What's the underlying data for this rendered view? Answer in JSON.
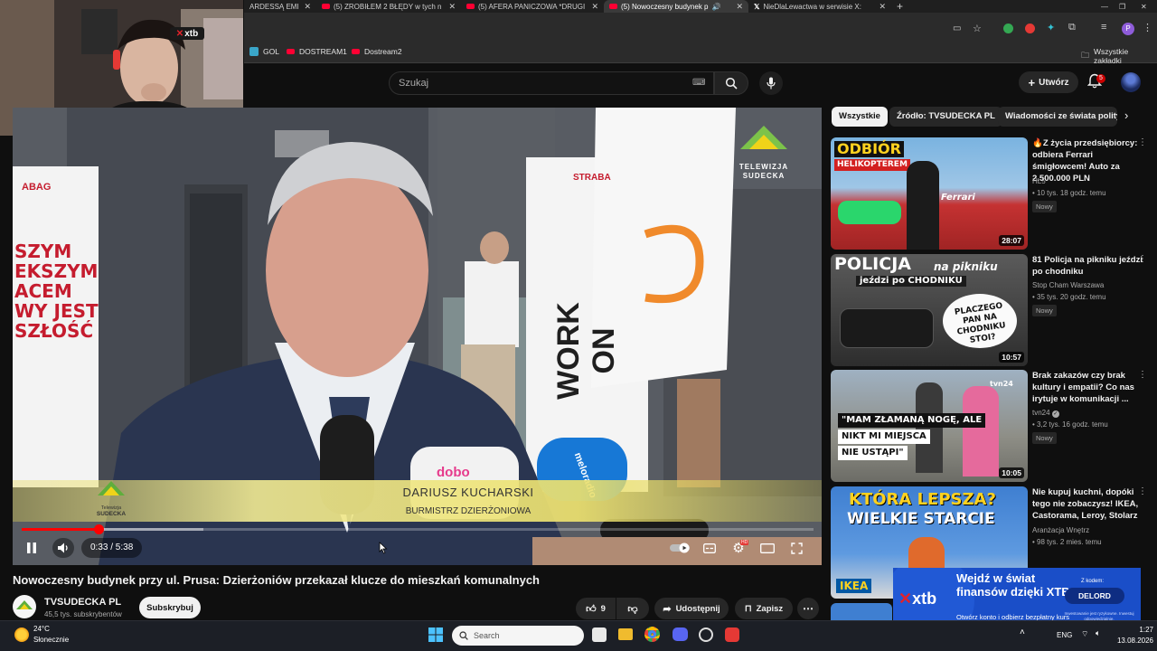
{
  "browser": {
    "tabs": [
      {
        "label": "ARDESSĄ EMI",
        "icon": "youtube-favicon"
      },
      {
        "label": "(5) ZROBIŁEM 2 BŁĘDY w tych n",
        "icon": "youtube-favicon"
      },
      {
        "label": "(5) AFERA PANICZOWA *DRUGI",
        "icon": "youtube-favicon"
      },
      {
        "label": "(5) Nowoczesny budynek p",
        "icon": "youtube-favicon"
      },
      {
        "label": "NieDlaLewactwa w serwisie X:",
        "icon": "x-favicon"
      }
    ],
    "active_tab_index": 3,
    "bookmarks": [
      {
        "label": "GOL",
        "color": "#3aa6c9"
      },
      {
        "label": "DOSTREAM1",
        "color": "#ff0033"
      },
      {
        "label": "Dostream2",
        "color": "#ff0033"
      }
    ],
    "all_bookmarks_label": "Wszystkie zakładki",
    "profile_letter": "P"
  },
  "webcam": {
    "badge_x": "✕",
    "badge_text": "xtb"
  },
  "header": {
    "search_placeholder": "Szukaj",
    "create_label": "Utwórz",
    "notification_count": "5"
  },
  "video": {
    "channel_logo_text": "TELEWIZJA SUDECKA",
    "lower_third": {
      "logo_line1": "Telewizja",
      "logo_line2": "SUDECKA",
      "name": "DARIUSZ KUCHARSKI",
      "role": "BURMISTRZ DZIERŻONIOWA"
    },
    "scene_text": {
      "banner_left": "SZYM\nEKSZYM\nACEM\nWY JEST\nSZŁOŚĆ",
      "strabag_left": "ABAG",
      "strabag_right": "STRABA",
      "work_on": "WORK ON",
      "mic_label1": "dobo",
      "mic_label2": "meloradio"
    },
    "time_current": "0:33",
    "time_total": "5:38",
    "time_display": "0:33 / 5:38",
    "progress": 0.0976,
    "buffered": 0.23,
    "title": "Nowoczesny budynek przy ul. Prusa: Dzierżoniów przekazał klucze do mieszkań komunalnych"
  },
  "channel": {
    "name": "TVSUDECKA PL",
    "subscribers": "45,5 tys. subskrybentów",
    "subscribe_label": "Subskrybuj"
  },
  "actions": {
    "like_count": "9",
    "share_label": "Udostępnij",
    "save_label": "Zapisz"
  },
  "chips": [
    "Wszystkie",
    "Źródło: TVSUDECKA PL",
    "Wiadomości ze świata polity"
  ],
  "recommendations": [
    {
      "title": "🔥Z życia przedsiębiorcy: odbiera Ferrari śmigłowcem! Auto za 2.500.000 PLN",
      "channel": "HL5",
      "meta": "10 tys.  18 godz. temu",
      "badge": "Nowy",
      "duration": "28:07",
      "thumb_text1": "ODBIÓR",
      "thumb_text2": "HELIKOPTEREM",
      "thumb_text3": "Ferrari"
    },
    {
      "title": "81 Policja na pikniku jeździ po chodniku",
      "channel": "Stop Cham Warszawa",
      "meta": "35 tys.  20 godz. temu",
      "badge": "Nowy",
      "duration": "10:57",
      "thumb_text1": "POLICJA",
      "thumb_text2": "na pikniku",
      "thumb_text3": "jeździ po CHODNIKU",
      "thumb_text4": "PLACZEGO PAN NA CHODNIKU STOI?"
    },
    {
      "title": "Brak zakazów czy brak kultury i empatii? Co nas irytuje w komunikacji ...",
      "channel": "tvn24",
      "verified": true,
      "meta": "3,2 tys.  16 godz. temu",
      "badge": "Nowy",
      "duration": "10:05",
      "thumb_text1": "\"MAM ZŁAMANĄ NOGĘ, ALE",
      "thumb_text2": "NIKT MI MIEJSCA",
      "thumb_text3": "NIE USTĄPI\"",
      "thumb_logo": "tvn24"
    },
    {
      "title": "Nie kupuj kuchni, dopóki tego nie zobaczysz! IKEA, Castorama, Leroy, Stolarz",
      "channel": "Aranżacja Wnętrz",
      "meta": "98 tys.  2 mies. temu",
      "duration": "",
      "thumb_text1": "KTÓRA LEPSZA?",
      "thumb_text2": "WIELKIE STARCIE",
      "thumb_text3": "IKEA"
    }
  ],
  "ad": {
    "logo": "xtb",
    "headline": "Wejdź w świat finansów dzięki XTB",
    "sub": "Otwórz konto i odbierz bezpłatny kurs",
    "code_label": "Z kodem:",
    "code": "DELORD",
    "disclaimer": "Inwestowanie jest ryzykowne. Inwestuj odpowiedzialnie."
  },
  "taskbar": {
    "weather_temp": "24°C",
    "weather_desc": "Słonecznie",
    "search_placeholder": "Search",
    "lang": "ENG",
    "time": "1:27",
    "date": "13.08.2026"
  },
  "colors": {
    "accent_red": "#ff0000",
    "lower_third_yellow": "#e9dc7a",
    "ad_blue": "#1a4ec8",
    "brand_green": "#6ab04c"
  }
}
